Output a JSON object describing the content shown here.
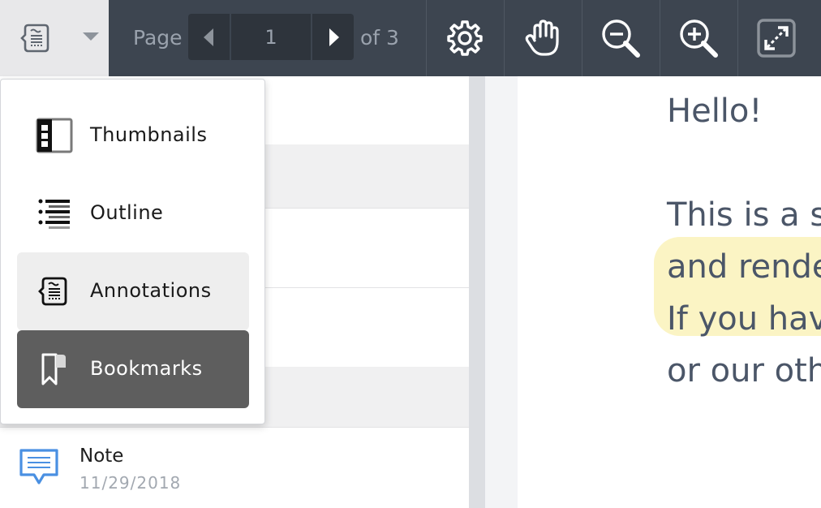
{
  "toolbar": {
    "page_label": "Page",
    "page_current": "1",
    "page_of": "of 3",
    "tools": [
      {
        "name": "settings-icon"
      },
      {
        "name": "pan-hand-icon"
      },
      {
        "name": "zoom-out-icon"
      },
      {
        "name": "zoom-in-icon"
      },
      {
        "name": "fullscreen-icon"
      }
    ],
    "panel_toggle_icon": "annotations-icon"
  },
  "menu": {
    "items": [
      {
        "label": "Thumbnails",
        "icon": "thumbnails-icon",
        "state": "normal"
      },
      {
        "label": "Outline",
        "icon": "outline-icon",
        "state": "normal"
      },
      {
        "label": "Annotations",
        "icon": "annotations-icon",
        "state": "hover"
      },
      {
        "label": "Bookmarks",
        "icon": "bookmark-icon",
        "state": "active"
      }
    ]
  },
  "annotation_list": {
    "note": {
      "title": "Note",
      "date": "11/29/2018",
      "icon": "comment-icon"
    }
  },
  "document": {
    "heading": "Hello!",
    "lines": [
      "This is a s",
      "and rende",
      "If you hav",
      "or our oth"
    ]
  },
  "colors": {
    "toolbar_bg": "#3d4550",
    "highlight": "#fbf4c4",
    "active_menu": "#5e5e5e",
    "note_icon": "#4a90e2",
    "doc_text": "#4b5668"
  }
}
